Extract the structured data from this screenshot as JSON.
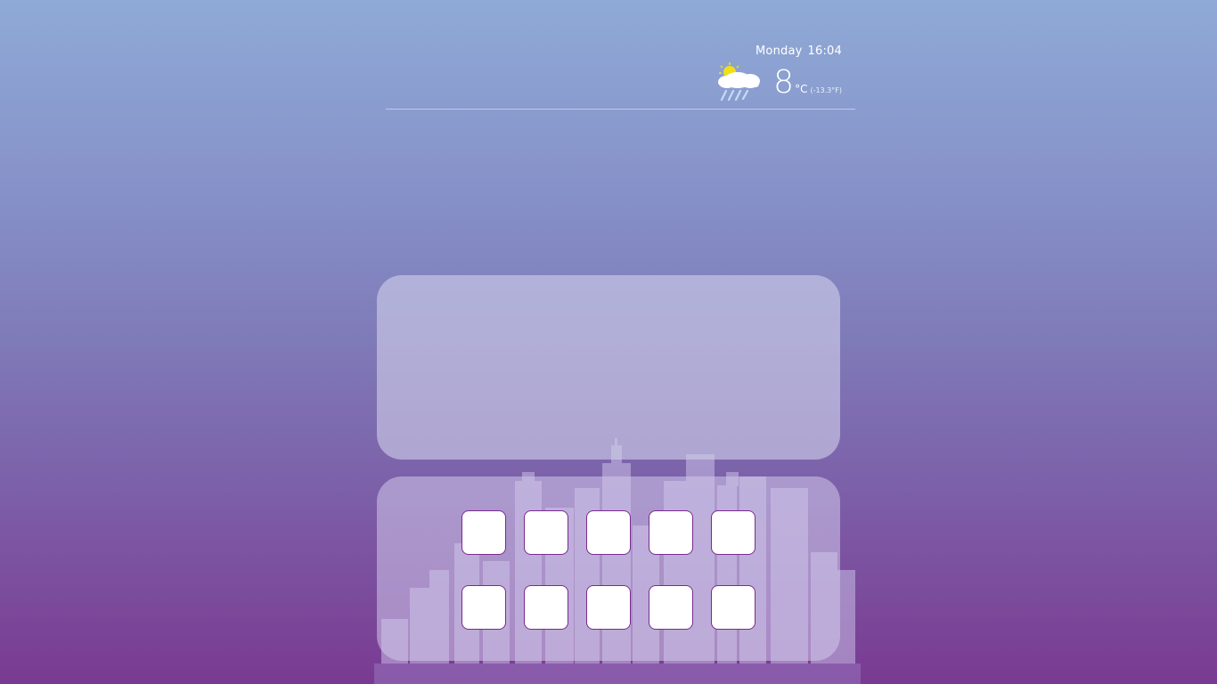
{
  "weather": {
    "day": "Monday",
    "time": "16:04",
    "temperature": "8",
    "unit": "°C",
    "fahrenheit": "(-13.3°F)",
    "icon": "partly-cloudy-rain-icon"
  },
  "colors": {
    "background_top": "#8faad6",
    "background_bottom": "#7a3a92",
    "tile_border": "#7a2b8e"
  },
  "tiles": {
    "row_1_count": 5,
    "row_2_count": 5
  }
}
